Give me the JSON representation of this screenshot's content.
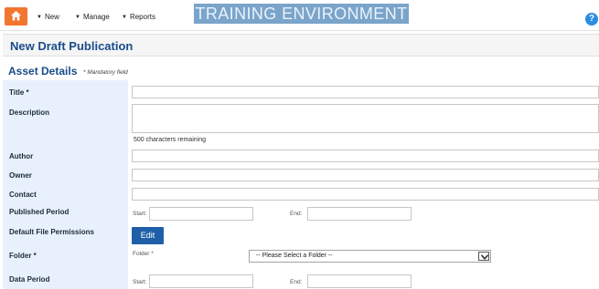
{
  "nav": {
    "menu": [
      {
        "label": "New"
      },
      {
        "label": "Manage"
      },
      {
        "label": "Reports"
      }
    ],
    "environment_banner": "TRAINING ENVIRONMENT",
    "help_glyph": "?"
  },
  "page": {
    "title": "New Draft Publication"
  },
  "section": {
    "title": "Asset Details",
    "mandatory_note": "* Mandatory field"
  },
  "fields": {
    "title_label": "Title *",
    "description_label": "Description",
    "description_counter": "500 characters remaining",
    "author_label": "Author",
    "owner_label": "Owner",
    "contact_label": "Contact",
    "published_period_label": "Published Period",
    "default_file_permissions_label": "Default File Permissions",
    "folder_label": "Folder *",
    "data_period_label": "Data Period",
    "start_label": "Start:",
    "end_label": "End:",
    "edit_button": "Edit",
    "folder_inline_label": "Folder *",
    "folder_select": {
      "selected": "-- Please Select a Folder --"
    }
  },
  "colors": {
    "accent": "#1a4c8b",
    "home": "#f2762e",
    "banner": "#7aa4ca",
    "button": "#1f5fa8",
    "label_column": "#e8f1fb"
  },
  "icons": {
    "home": "home-icon",
    "help": "help-icon",
    "dropdown": "chevron-down-icon"
  }
}
